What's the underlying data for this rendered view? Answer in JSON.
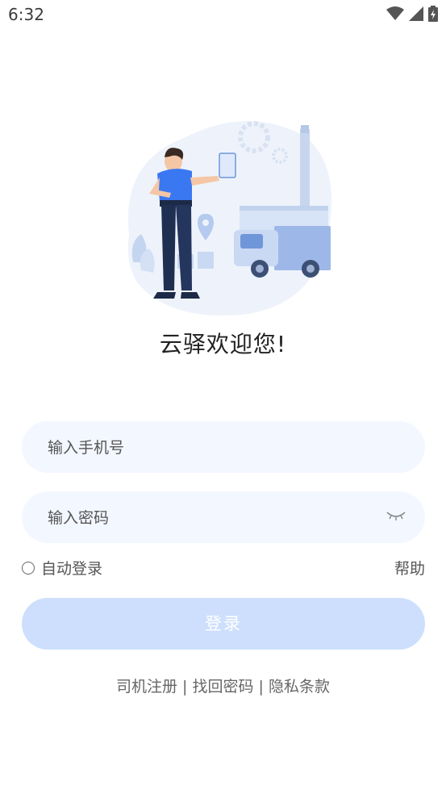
{
  "status_bar": {
    "time": "6:32",
    "icons": [
      "wifi-icon",
      "signal-icon",
      "battery-charging-icon"
    ]
  },
  "hero": {
    "illustration": "delivery-driver-illustration"
  },
  "welcome_text": "云驿欢迎您!",
  "login_form": {
    "phone_placeholder": "输入手机号",
    "password_placeholder": "输入密码",
    "password_toggle_icon": "eye-closed-icon",
    "auto_login_label": "自动登录",
    "help_label": "帮助",
    "login_button": "登录"
  },
  "footer": {
    "driver_register": "司机注册",
    "separator": " | ",
    "find_password": "找回密码",
    "privacy_terms": "隐私条款"
  },
  "colors": {
    "field_bg": "#f3f7ff",
    "button_bg": "#cddffd",
    "accent": "#3a78f2"
  }
}
